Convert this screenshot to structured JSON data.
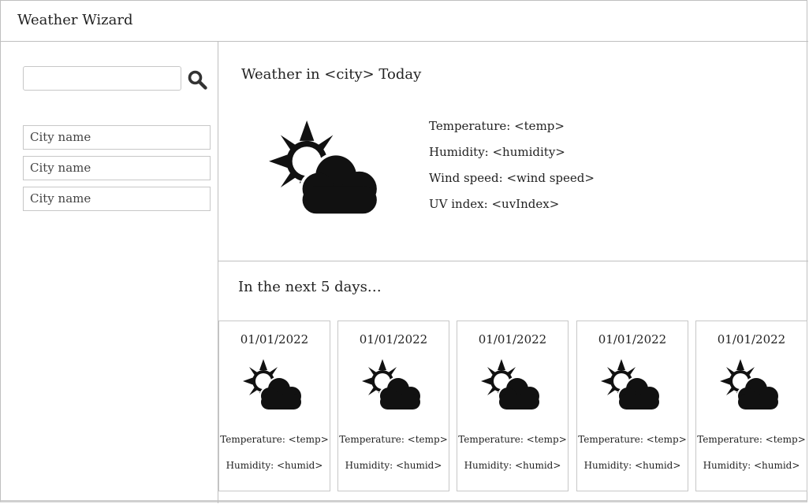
{
  "app": {
    "title": "Weather Wizard"
  },
  "search": {
    "placeholder": "",
    "value": ""
  },
  "history": [
    {
      "label": "City name"
    },
    {
      "label": "City name"
    },
    {
      "label": "City name"
    }
  ],
  "today": {
    "title": "Weather in <city> Today",
    "icon": "partly-cloudy-icon",
    "temperature": "Temperature: <temp>",
    "humidity": "Humidity: <humidity>",
    "wind": "Wind speed: <wind speed>",
    "uv": "UV index: <uvIndex>"
  },
  "forecast": {
    "title": "In the next 5 days…",
    "days": [
      {
        "date": "01/01/2022",
        "icon": "partly-cloudy-icon",
        "temp": "Temperature: <temp>",
        "humid": "Humidity: <humid>"
      },
      {
        "date": "01/01/2022",
        "icon": "partly-cloudy-icon",
        "temp": "Temperature: <temp>",
        "humid": "Humidity: <humid>"
      },
      {
        "date": "01/01/2022",
        "icon": "partly-cloudy-icon",
        "temp": "Temperature: <temp>",
        "humid": "Humidity: <humid>"
      },
      {
        "date": "01/01/2022",
        "icon": "partly-cloudy-icon",
        "temp": "Temperature: <temp>",
        "humid": "Humidity: <humid>"
      },
      {
        "date": "01/01/2022",
        "icon": "partly-cloudy-icon",
        "temp": "Temperature: <temp>",
        "humid": "Humidity: <humid>"
      }
    ]
  }
}
